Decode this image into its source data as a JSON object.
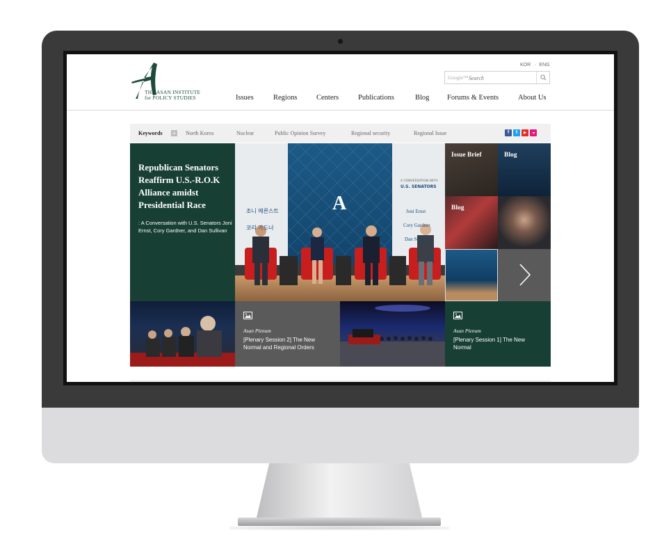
{
  "header": {
    "logo": {
      "mark": "A",
      "line1": "THE ASAN INSTITUTE",
      "line2": "for POLICY STUDIES"
    },
    "lang": [
      "KOR",
      "ENG"
    ],
    "search": {
      "brand": "Google™",
      "placeholder": "Search"
    },
    "nav": [
      "Issues",
      "Regions",
      "Centers",
      "Publications",
      "Blog",
      "Forums & Events",
      "About Us"
    ]
  },
  "keywords": {
    "label": "Keywords",
    "plus": "+",
    "items": [
      "North Korea",
      "Nuclear",
      "Public Opinion Survey",
      "Regional security",
      "Regional Issue"
    ],
    "social": [
      {
        "icon": "facebook-icon",
        "glyph": "f",
        "color": "#3b5998"
      },
      {
        "icon": "twitter-icon",
        "glyph": "t",
        "color": "#1da1f2"
      },
      {
        "icon": "youtube-icon",
        "glyph": "▶",
        "color": "#e52d27"
      },
      {
        "icon": "flickr-icon",
        "glyph": "●●",
        "color": "#e3197b"
      }
    ]
  },
  "feature": {
    "title": "Republican Senators Reaffirm U.S.-R.O.K Alliance amidst Presidential Race",
    "subtitle": ": A Conversation with U.S. Senators Joni Ernst, Cory Gardner, and Dan Sullivan"
  },
  "main_photo": {
    "banner_left": [
      "조니 에른스트",
      "코리 가드너"
    ],
    "banner_right_small": "A CONVERSATION WITH",
    "banner_right_head": "U.S. SENATORS",
    "banner_right_names": [
      "Joni Ernst",
      "Cory Gardner",
      "Dan Sullivan"
    ]
  },
  "tiles": {
    "issue_brief": "Issue Brief",
    "blog_1": "Blog",
    "blog_2": "Blog"
  },
  "bottom_cards": [
    {
      "kicker": "Asan Plenum",
      "title": "[Plenary Session 2] The New Normal and Regional Orders"
    },
    {
      "kicker": "Asan Plenum",
      "title": "[Plenary Session 1] The New Normal"
    }
  ],
  "colors": {
    "brand_green": "#173f33",
    "caption_gray": "#5a5a5a",
    "bezel": "#3a3a3a"
  }
}
